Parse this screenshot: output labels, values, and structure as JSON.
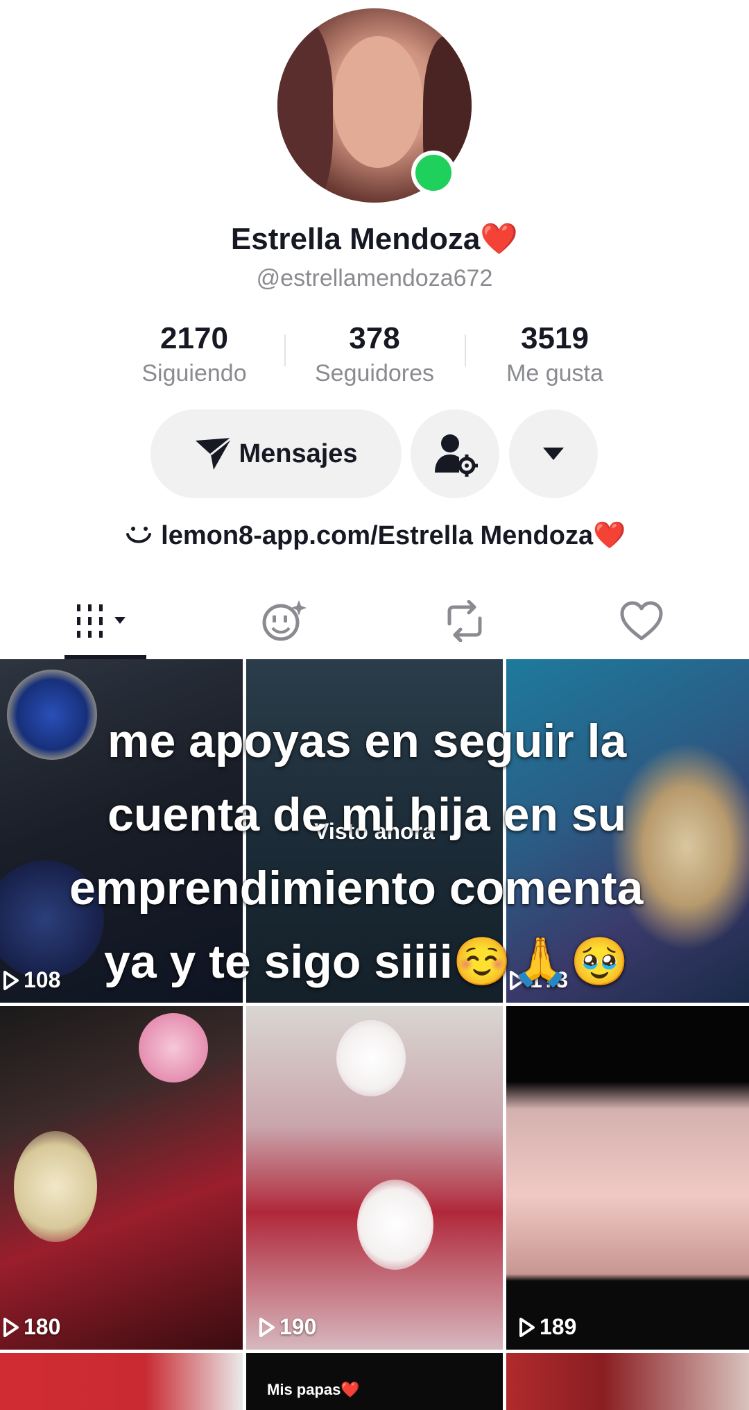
{
  "profile": {
    "display_name": "Estrella Mendoza❤️",
    "handle": "@estrellamendoza672",
    "link": "lemon8-app.com/Estrella Mendoza❤️",
    "online_color": "#20d05c"
  },
  "stats": [
    {
      "value": "2170",
      "label": "Siguiendo"
    },
    {
      "value": "378",
      "label": "Seguidores"
    },
    {
      "value": "3519",
      "label": "Me gusta"
    }
  ],
  "buttons": {
    "message_label": "Mensajes",
    "message_icon": "paper-plane-icon",
    "add_friend_icon": "person-gear-icon",
    "more_icon": "triangle-down-icon"
  },
  "tabs": [
    {
      "name": "videos",
      "icon": "grid-bars-icon",
      "active": true
    },
    {
      "name": "ai-effects",
      "icon": "smile-sparkle-icon",
      "active": false
    },
    {
      "name": "reposts",
      "icon": "repost-icon",
      "active": false
    },
    {
      "name": "liked",
      "icon": "heart-outline-icon",
      "active": false
    }
  ],
  "videos": [
    {
      "views": "108"
    },
    {
      "views": "",
      "status": "Visto ahora"
    },
    {
      "views": "1?3"
    },
    {
      "views": "180"
    },
    {
      "views": "190"
    },
    {
      "views": "189"
    }
  ],
  "overlay_text": {
    "line1": "me apoyas en seguir la",
    "line2": "cuenta de mi hija en su",
    "line3": "emprendimiento comenta",
    "line4": "ya y te sigo siiii☺️🙏🥹"
  },
  "bottom_row": {
    "middle_caption": "Mis papas❤️"
  }
}
